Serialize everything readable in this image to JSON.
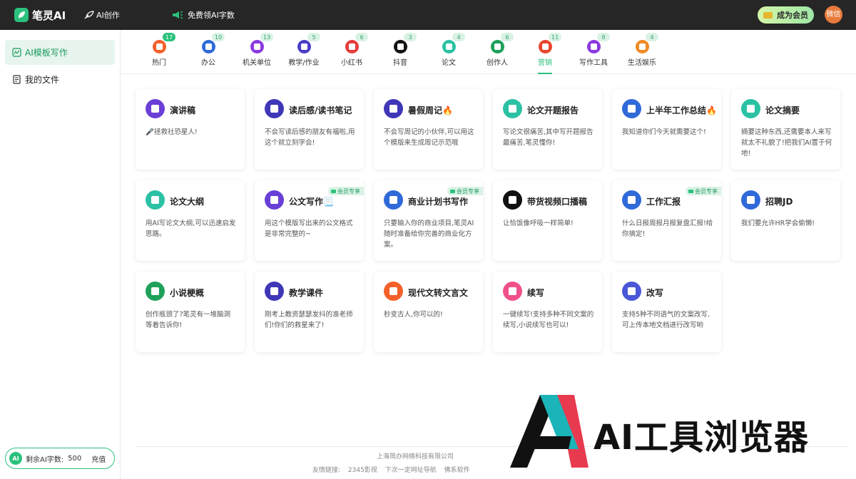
{
  "header": {
    "app_name": "笔灵AI",
    "create_label": "AI创作",
    "free_label": "免费领AI字数",
    "vip_label": "成为会员",
    "avatar_text": "微信"
  },
  "sidebar": {
    "items": [
      {
        "label": "AI模板写作",
        "icon": "template-icon"
      },
      {
        "label": "我的文件",
        "icon": "file-icon"
      }
    ],
    "quota": {
      "icon_text": "AI",
      "label": "剩余AI字数:",
      "value": "500",
      "recharge": "充值"
    }
  },
  "tabs": [
    {
      "label": "热门",
      "count": "17",
      "icon": "fire-icon",
      "color": "#f4602a"
    },
    {
      "label": "办公",
      "count": "10",
      "icon": "briefcase-icon",
      "color": "#2f6ad9"
    },
    {
      "label": "机关单位",
      "count": "13",
      "icon": "star-icon",
      "color": "#8b3ae0"
    },
    {
      "label": "教学/作业",
      "count": "5",
      "icon": "graduation-icon",
      "color": "#4a3ec8"
    },
    {
      "label": "小红书",
      "count": "6",
      "icon": "xiaohongshu-icon",
      "color": "#e53d3d"
    },
    {
      "label": "抖音",
      "count": "3",
      "icon": "tiktok-icon",
      "color": "#111111"
    },
    {
      "label": "论文",
      "count": "4",
      "icon": "document-icon",
      "color": "#2bc1a4"
    },
    {
      "label": "创作人",
      "count": "6",
      "icon": "pen-icon",
      "color": "#1fa15a"
    },
    {
      "label": "营销",
      "count": "11",
      "icon": "chart-icon",
      "color": "#e8452f"
    },
    {
      "label": "写作工具",
      "count": "8",
      "icon": "tool-icon",
      "color": "#8b3ae0"
    },
    {
      "label": "生活娱乐",
      "count": "4",
      "icon": "hammer-icon",
      "color": "#f08a24"
    }
  ],
  "active_tab": "营销",
  "cards": [
    {
      "title": "演讲稿",
      "desc": "🎤拯救社恐星人!",
      "icon": "star-icon",
      "color": "#6a3fd6",
      "vip": false
    },
    {
      "title": "读后感/读书笔记",
      "desc": "不会写读后感的朋友有福啦,用这个就立刻学会!",
      "icon": "graduation-icon",
      "color": "#3f37b8",
      "vip": false
    },
    {
      "title": "暑假周记🔥",
      "desc": "不会写周记的小伙伴,可以用这个模版来生成周记示范哦",
      "icon": "graduation-icon",
      "color": "#3f37b8",
      "vip": false
    },
    {
      "title": "论文开题报告",
      "desc": "写论文很痛苦,其中写开题报告最痛苦,笔灵懂你!",
      "icon": "document-icon",
      "color": "#2bc1a4",
      "vip": false
    },
    {
      "title": "上半年工作总结🔥",
      "desc": "我知道你们今天就需要这个!",
      "icon": "briefcase-icon",
      "color": "#2f6ad9",
      "vip": false
    },
    {
      "title": "论文摘要",
      "desc": "摘要这种东西,还需要本人来写就太不礼貌了!把我们AI置于何地!",
      "icon": "document-icon",
      "color": "#2bc1a4",
      "vip": false
    },
    {
      "title": "论文大纲",
      "desc": "用AI写论文大纲,可以迅速启发思路。",
      "icon": "document-icon",
      "color": "#2bc1a4",
      "vip": false
    },
    {
      "title": "公文写作📃",
      "desc": "用这个模版写出来的公文格式是非常完整的~",
      "icon": "star-icon",
      "color": "#6a3fd6",
      "vip": true
    },
    {
      "title": "商业计划书写作",
      "desc": "只要输入你的商业项目,笔灵AI随时准备给你完善的商业化方案。",
      "icon": "briefcase-icon",
      "color": "#2f6ad9",
      "vip": true
    },
    {
      "title": "带货视频口播稿",
      "desc": "让恰饭像呼吸一样简单!",
      "icon": "tiktok-icon",
      "color": "#111111",
      "vip": false
    },
    {
      "title": "工作汇报",
      "desc": "什么日报周报月报复盘汇报!给你搞定!",
      "icon": "briefcase-icon",
      "color": "#2f6ad9",
      "vip": true
    },
    {
      "title": "招聘JD",
      "desc": "我们要允许HR学会偷懒!",
      "icon": "briefcase-icon",
      "color": "#2f6ad9",
      "vip": false
    },
    {
      "title": "小说梗概",
      "desc": "创作瓶颈了?笔灵有一堆脑洞等着告诉你!",
      "icon": "pen-icon",
      "color": "#1fa15a",
      "vip": false
    },
    {
      "title": "教学课件",
      "desc": "刚考上教资瑟瑟发抖的准老师们!你们的救星来了!",
      "icon": "graduation-icon",
      "color": "#3f37b8",
      "vip": false
    },
    {
      "title": "现代文转文言文",
      "desc": "秒变古人,你可以的!",
      "icon": "fire-icon",
      "color": "#f4602a",
      "vip": false
    },
    {
      "title": "续写",
      "desc": "一键续写!支持多种不同文案的续写,小说续写也可以!",
      "icon": "continue-icon",
      "color": "#f0508a",
      "vip": false
    },
    {
      "title": "改写",
      "desc": "支持5种不同语气的文案改写,可上传本地文档进行改写哟",
      "icon": "rewrite-icon",
      "color": "#4a57d8",
      "vip": false
    }
  ],
  "vip_tag": "会员专享",
  "footer": {
    "company": "上海简办网络科技有限公司",
    "links_label": "友情链接:",
    "links": [
      "2345影视",
      "下次一定网址导航",
      "佛系软件"
    ]
  },
  "watermark": "AI工具浏览器"
}
